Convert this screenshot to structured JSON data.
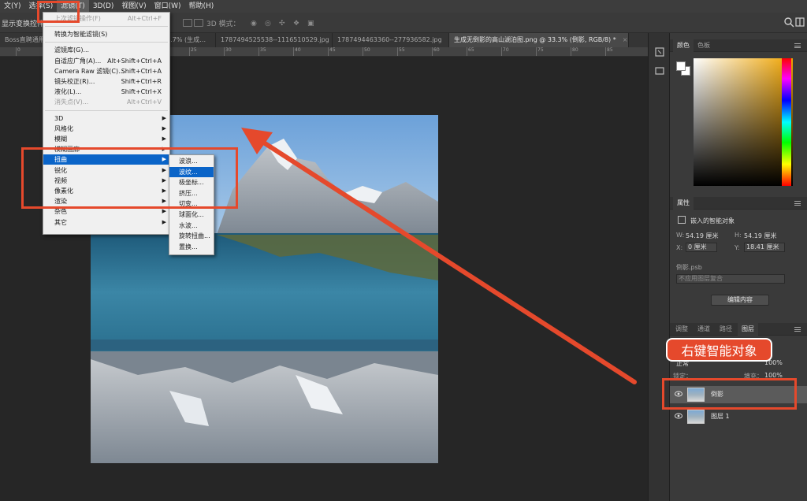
{
  "menubar": {
    "items": [
      "文(Y)",
      "选择(S)",
      "滤镜(T)",
      "3D(D)",
      "视图(V)",
      "窗口(W)",
      "帮助(H)"
    ],
    "active_index": 2
  },
  "options_bar": {
    "label": "显示变换控件",
    "mode_3d": "3D 模式："
  },
  "tabs": [
    {
      "label": "Boss直聘通用显",
      "close": ""
    },
    {
      "label": "66.7% (生成…",
      "close": ""
    },
    {
      "label": "1787494525538--1116510529.jpg",
      "close": "×"
    },
    {
      "label": "1787494463360--277936582.jpg",
      "close": "×"
    },
    {
      "label": "生成无倒影的高山湖泊图.png @ 33.3% (倒影, RGB/8) *",
      "close": "×",
      "active": true
    }
  ],
  "ruler": {
    "labels": [
      "0",
      "5",
      "10",
      "15",
      "20",
      "25",
      "30",
      "35",
      "40",
      "45",
      "50",
      "55",
      "60",
      "65",
      "70",
      "75",
      "80",
      "85"
    ]
  },
  "filter_menu": {
    "items": [
      {
        "label": "上次滤镜操作(F)",
        "shortcut": "Alt+Ctrl+F",
        "disabled": true
      },
      {
        "sep": true
      },
      {
        "label": "转换为智能滤镜(S)",
        "shortcut": ""
      },
      {
        "sep": true
      },
      {
        "label": "滤镜库(G)...",
        "shortcut": ""
      },
      {
        "label": "自适应广角(A)...",
        "shortcut": "Alt+Shift+Ctrl+A"
      },
      {
        "label": "Camera Raw 滤镜(C)...",
        "shortcut": "Shift+Ctrl+A"
      },
      {
        "label": "镜头校正(R)...",
        "shortcut": "Shift+Ctrl+R"
      },
      {
        "label": "液化(L)...",
        "shortcut": "Shift+Ctrl+X"
      },
      {
        "label": "消失点(V)...",
        "shortcut": "Alt+Ctrl+V",
        "disabled": true
      },
      {
        "sep": true
      },
      {
        "label": "3D",
        "arrow": true
      },
      {
        "label": "风格化",
        "arrow": true
      },
      {
        "label": "模糊",
        "arrow": true
      },
      {
        "label": "模糊画廊",
        "arrow": true
      },
      {
        "label": "扭曲",
        "arrow": true,
        "highlight": true
      },
      {
        "label": "锐化",
        "arrow": true
      },
      {
        "label": "视频",
        "arrow": true
      },
      {
        "label": "像素化",
        "arrow": true
      },
      {
        "label": "渲染",
        "arrow": true
      },
      {
        "label": "杂色",
        "arrow": true
      },
      {
        "label": "其它",
        "arrow": true
      }
    ]
  },
  "distort_submenu": {
    "items": [
      "波浪...",
      "波纹...",
      "极坐标...",
      "挤压...",
      "切变...",
      "球面化...",
      "水波...",
      "旋转扭曲...",
      "置换..."
    ],
    "highlight_index": 1
  },
  "color_panel": {
    "tabs": [
      "颜色",
      "色板"
    ]
  },
  "properties_panel": {
    "title": "属性",
    "type": "嵌入的智能对象",
    "w_label": "W:",
    "w_value": "54.19 厘米",
    "h_label": "H:",
    "h_value": "54.19 厘米",
    "x_label": "X:",
    "x_value": "0 厘米",
    "y_label": "Y:",
    "y_value": "18.41 厘米",
    "file": "倒影.psb",
    "comp": "不应用图层复合",
    "edit_button": "编辑内容"
  },
  "layers_panel": {
    "tabs": [
      "调整",
      "通道",
      "路径",
      "图层"
    ],
    "active_tab": 3,
    "blend": "正常",
    "opacity": "100%",
    "lock_label": "锁定：",
    "fill_label": "填充：",
    "fill_value": "100%",
    "layers": [
      {
        "name": "倒影",
        "selected": true
      },
      {
        "name": "图层 1",
        "selected": false
      }
    ]
  },
  "annotation": {
    "label": "右键智能对象",
    "color": "#e5492c"
  }
}
